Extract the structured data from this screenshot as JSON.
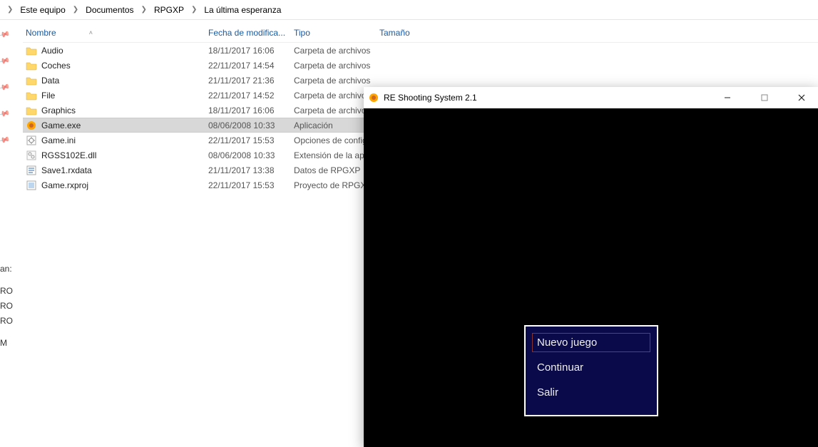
{
  "breadcrumb": [
    "Este equipo",
    "Documentos",
    "RPGXP",
    "La última esperanza"
  ],
  "columns": {
    "name": "Nombre",
    "date": "Fecha de modifica...",
    "type": "Tipo",
    "size": "Tamaño"
  },
  "files": [
    {
      "icon": "folder-icon",
      "name": "Audio",
      "date": "18/11/2017 16:06",
      "type": "Carpeta de archivos",
      "selected": false
    },
    {
      "icon": "folder-icon",
      "name": "Coches",
      "date": "22/11/2017 14:54",
      "type": "Carpeta de archivos",
      "selected": false
    },
    {
      "icon": "folder-icon",
      "name": "Data",
      "date": "21/11/2017 21:36",
      "type": "Carpeta de archivos",
      "selected": false
    },
    {
      "icon": "folder-icon",
      "name": "File",
      "date": "22/11/2017 14:52",
      "type": "Carpeta de archivos",
      "selected": false
    },
    {
      "icon": "folder-icon",
      "name": "Graphics",
      "date": "18/11/2017 16:06",
      "type": "Carpeta de archivos",
      "selected": false
    },
    {
      "icon": "exe-icon",
      "name": "Game.exe",
      "date": "08/06/2008 10:33",
      "type": "Aplicación",
      "selected": true
    },
    {
      "icon": "ini-icon",
      "name": "Game.ini",
      "date": "22/11/2017 15:53",
      "type": "Opciones de configuración",
      "selected": false
    },
    {
      "icon": "dll-icon",
      "name": "RGSS102E.dll",
      "date": "08/06/2008 10:33",
      "type": "Extensión de la aplicación",
      "selected": false
    },
    {
      "icon": "data-icon",
      "name": "Save1.rxdata",
      "date": "21/11/2017 13:38",
      "type": "Datos de RPGXP",
      "selected": false
    },
    {
      "icon": "proj-icon",
      "name": "Game.rxproj",
      "date": "22/11/2017 15:53",
      "type": "Proyecto de RPGXP",
      "selected": false
    }
  ],
  "sidebar_fragments": [
    "an:",
    "",
    "RO",
    "RO",
    "RO",
    "",
    "M"
  ],
  "game_window": {
    "title": "RE Shooting System 2.1",
    "menu": [
      {
        "label": "Nuevo juego",
        "selected": true
      },
      {
        "label": "Continuar",
        "selected": false
      },
      {
        "label": "Salir",
        "selected": false
      }
    ]
  }
}
